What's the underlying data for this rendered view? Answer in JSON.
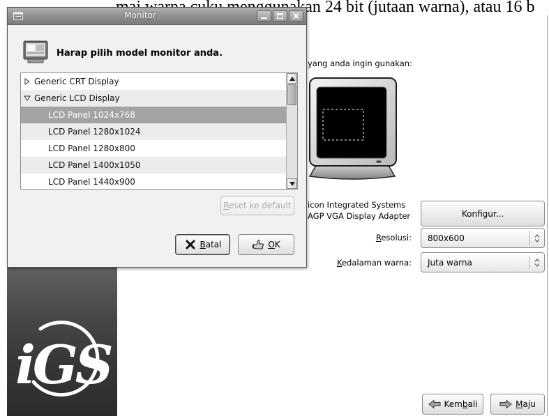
{
  "document_text": "mai warna cuku menggunakan 24 bit (jutaan warna), atau 16 b",
  "installer": {
    "logo_text": "iGS",
    "instruction": "yang anda ingin gunakan:",
    "adapter_line1": "icon Integrated Systems",
    "adapter_line2": "AGP VGA Display Adapter",
    "configure_label": "Konfigur...",
    "resolution_label": "Resolusi:",
    "resolution_value": "800x600",
    "color_depth_label": "Kedalaman warna:",
    "color_depth_value": "Juta warna",
    "back_label": "Kembali",
    "next_label": "Maju"
  },
  "dialog": {
    "title": "Monitor",
    "heading": "Harap pilih model monitor anda.",
    "monitor_list": [
      {
        "label": "Generic CRT Display",
        "expandable": true,
        "expanded": false
      },
      {
        "label": "Generic LCD Display",
        "expandable": true,
        "expanded": true
      },
      {
        "label": "LCD Panel 1024x768",
        "selected": true
      },
      {
        "label": "LCD Panel 1280x1024",
        "selected": false
      },
      {
        "label": "LCD Panel 1280x800",
        "selected": false
      },
      {
        "label": "LCD Panel 1400x1050",
        "selected": false
      },
      {
        "label": "LCD Panel 1440x900",
        "selected": false
      }
    ],
    "reset_label": "Reset ke default",
    "reset_enabled": false,
    "cancel_label": "Batal",
    "ok_label": "OK"
  },
  "icons": {
    "window_menu": "window-menu-icon",
    "minimize": "minimize-icon",
    "maximize": "maximize-icon",
    "close": "close-icon",
    "header": "monitor-icon",
    "collapsed": "collapsed-arrow-icon",
    "expanded": "expanded-arrow-icon",
    "cancel": "cancel-icon",
    "ok": "ok-icon",
    "back": "back-arrow-icon",
    "next": "forward-arrow-icon",
    "spin": "spin-arrows-icon"
  },
  "colors": {
    "titlebar": "#8c8c8c",
    "selection": "#a3a3a3",
    "dialog_bg": "#f1f1f1",
    "sidebar": "#4a4a4a",
    "disabled_text": "#a2a2a2"
  }
}
